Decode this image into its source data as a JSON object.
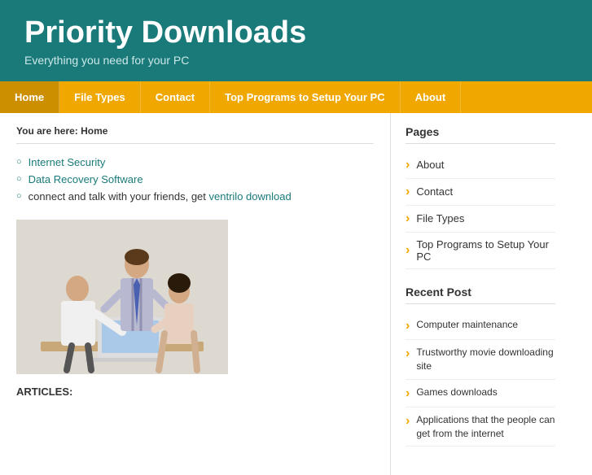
{
  "header": {
    "title": "Priority Downloads",
    "tagline": "Everything you need for your PC"
  },
  "nav": {
    "items": [
      {
        "label": "Home",
        "active": true
      },
      {
        "label": "File Types",
        "active": false
      },
      {
        "label": "Contact",
        "active": false
      },
      {
        "label": "Top Programs to Setup Your PC",
        "active": false
      },
      {
        "label": "About",
        "active": false
      }
    ]
  },
  "breadcrumb": {
    "prefix": "You are here: ",
    "current": "Home"
  },
  "content": {
    "list": [
      {
        "type": "link",
        "text": "Internet Security",
        "href": "#"
      },
      {
        "type": "link",
        "text": "Data Recovery Software",
        "href": "#"
      },
      {
        "type": "mixed",
        "before": "connect and talk with your friends, get ",
        "link_text": "ventrilo download",
        "link_href": "#",
        "after": ""
      }
    ],
    "articles_label": "ARTICLES:"
  },
  "sidebar": {
    "pages_title": "Pages",
    "pages_items": [
      {
        "label": "About"
      },
      {
        "label": "Contact"
      },
      {
        "label": "File Types"
      },
      {
        "label": "Top Programs to Setup Your PC"
      }
    ],
    "recent_post_title": "Recent Post",
    "recent_posts": [
      {
        "label": "Computer maintenance"
      },
      {
        "label": "Trustworthy movie downloading site"
      },
      {
        "label": "Games downloads"
      },
      {
        "label": "Applications that the people can get from the internet"
      }
    ]
  },
  "colors": {
    "teal": "#1a7a7a",
    "gold": "#f0a800",
    "white": "#ffffff"
  }
}
